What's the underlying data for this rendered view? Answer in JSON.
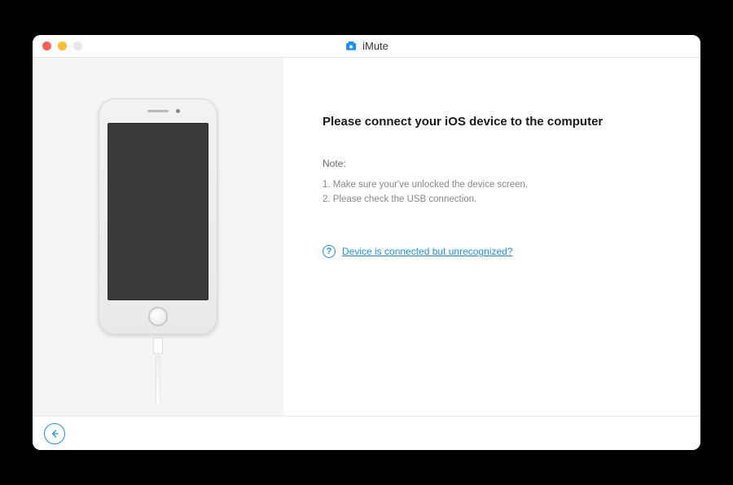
{
  "app": {
    "name": "iMute"
  },
  "main": {
    "heading": "Please connect your iOS device to the computer",
    "note_label": "Note:",
    "notes": [
      "Make sure your've unlocked the device screen.",
      "Please check the USB connection."
    ]
  },
  "help": {
    "link_text": "Device is connected but unrecognized?"
  },
  "colors": {
    "accent": "#1790ff"
  }
}
